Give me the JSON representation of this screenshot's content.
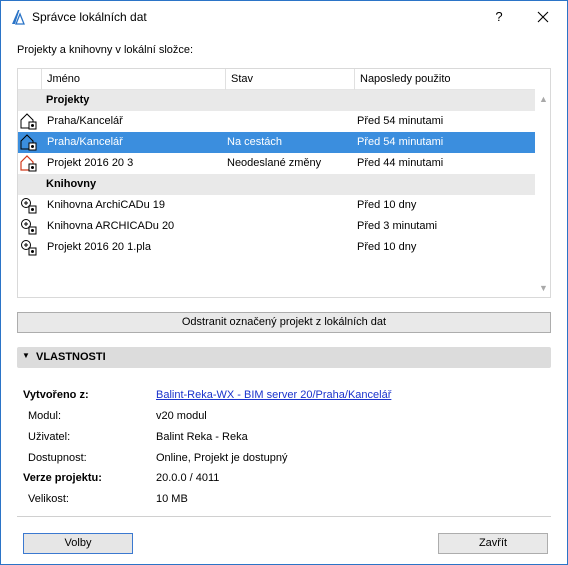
{
  "window": {
    "title": "Správce lokálních dat",
    "help_label": "?",
    "close_label": "✕"
  },
  "section_label": "Projekty a knihovny v lokální složce:",
  "table": {
    "columns": [
      "Jméno",
      "Stav",
      "Naposledy použito"
    ],
    "groups": {
      "projects": "Projekty",
      "libraries": "Knihovny"
    },
    "rows": [
      {
        "icon": "project-house-icon",
        "name": "Praha/Kancelář",
        "stav": "",
        "last": "Před 54 minutami"
      },
      {
        "icon": "project-house-icon",
        "name": "Praha/Kancelář",
        "stav": "Na cestách",
        "last": "Před 54 minutami",
        "selected": true
      },
      {
        "icon": "project-house-red-icon",
        "name": "Projekt 2016 20 3",
        "stav": "Neodeslané změny",
        "last": "Před 44 minutami"
      },
      {
        "icon": "library-icon",
        "name": "Knihovna ArchiCADu 19",
        "stav": "",
        "last": "Před 10 dny"
      },
      {
        "icon": "library-icon",
        "name": "Knihovna ARCHICADu 20",
        "stav": "",
        "last": "Před 3 minutami"
      },
      {
        "icon": "library-icon",
        "name": "Projekt 2016 20 1.pla",
        "stav": "",
        "last": "Před 10 dny"
      }
    ]
  },
  "remove_button": "Odstranit označený projekt z lokálních dat",
  "properties": {
    "title": "VLASTNOSTI",
    "created_from_label": "Vytvořeno z:",
    "created_from_value": "Balint-Reka-WX - BIM server 20/Praha/Kancelář",
    "module_label": "Modul:",
    "module_value": "v20 modul",
    "user_label": "Uživatel:",
    "user_value": "Balint Reka - Reka",
    "availability_label": "Dostupnost:",
    "availability_value": "Online, Projekt je dostupný",
    "version_label": "Verze projektu:",
    "version_value": "20.0.0 / 4011",
    "size_label": "Velikost:",
    "size_value": "10 MB"
  },
  "buttons": {
    "options": "Volby",
    "close": "Zavřít"
  },
  "colors": {
    "selection": "#3b8ede",
    "link": "#1a33cc",
    "accent": "#2b74c7"
  }
}
